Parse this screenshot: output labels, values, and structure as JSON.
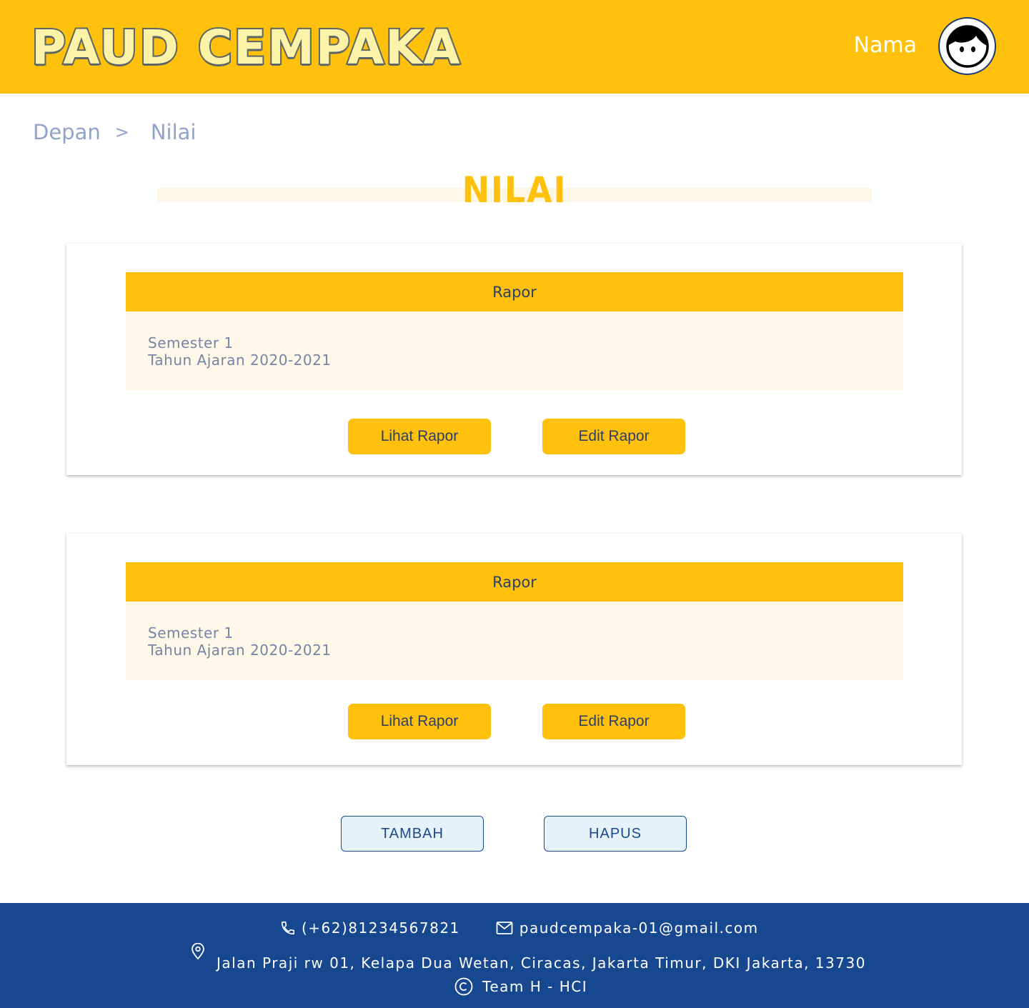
{
  "header": {
    "logo_text": "PAUD CEMPAKA",
    "user_name": "Nama",
    "avatar_icon": "boy-face-icon"
  },
  "breadcrumb": {
    "home": "Depan",
    "separator": ">",
    "current": "Nilai"
  },
  "page": {
    "title": "NILAI"
  },
  "reports": [
    {
      "header": "Rapor",
      "semester": "Semester 1",
      "year": "Tahun Ajaran 2020-2021",
      "view_label": "Lihat Rapor",
      "edit_label": "Edit Rapor"
    },
    {
      "header": "Rapor",
      "semester": "Semester 1",
      "year": "Tahun Ajaran 2020-2021",
      "view_label": "Lihat Rapor",
      "edit_label": "Edit Rapor"
    }
  ],
  "actions": {
    "add_label": "TAMBAH",
    "delete_label": "HAPUS"
  },
  "footer": {
    "phone": "(+62)81234567821",
    "email": "paudcempaka-01@gmail.com",
    "address": "Jalan Praji rw 01, Kelapa Dua Wetan, Ciracas, Jakarta Timur, DKI Jakarta, 13730",
    "credit": "Team H - HCI",
    "icons": [
      "phone-icon",
      "mail-icon",
      "location-pin-icon",
      "copyright-icon"
    ]
  },
  "colors": {
    "primary_yellow": "#FFC10B",
    "light_cream": "#FFF7E8",
    "footer_blue": "#17478F",
    "text_navy": "#2d3f66"
  }
}
